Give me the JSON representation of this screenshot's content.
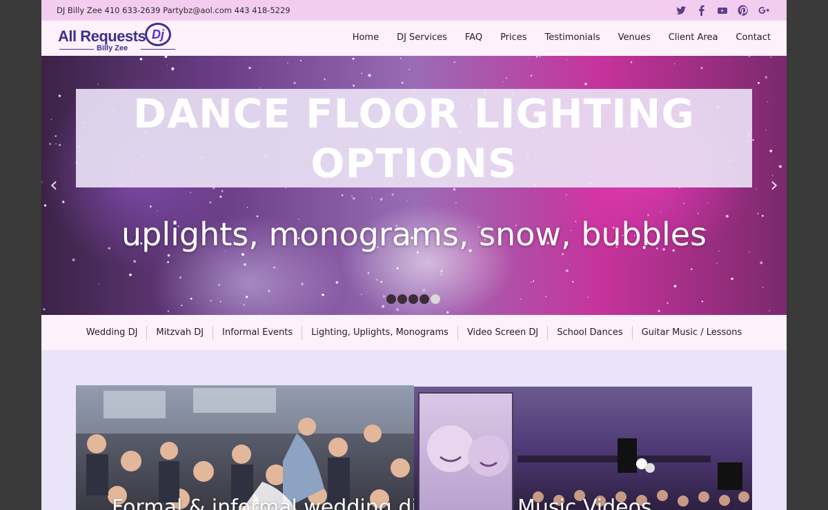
{
  "topbar": {
    "contact": "DJ Billy Zee 410 633-2639 Partybz@aol.com 443 418-5229",
    "social": [
      {
        "icon": "twitter-icon",
        "glyph": "t"
      },
      {
        "icon": "facebook-icon",
        "glyph": "f"
      },
      {
        "icon": "youtube-icon",
        "glyph": "You"
      },
      {
        "icon": "pinterest-icon",
        "glyph": "P"
      },
      {
        "icon": "google-plus-icon",
        "glyph": "g+"
      }
    ]
  },
  "logo": {
    "main": "All Requests",
    "badge": "Dj",
    "sub": "Billy Zee"
  },
  "nav": {
    "items": [
      "Home",
      "DJ Services",
      "FAQ",
      "Prices",
      "Testimonials",
      "Venues",
      "Client Area",
      "Contact"
    ]
  },
  "hero": {
    "title_line1": "DANCE FLOOR LIGHTING",
    "title_line2": "OPTIONS",
    "subtitle": "uplights, monograms, snow, bubbles",
    "prev": "‹",
    "next": "›",
    "slide_count": 5,
    "active_slide": 5
  },
  "services": {
    "items": [
      "Wedding DJ",
      "Mitzvah DJ",
      "Informal Events",
      "Lighting, Uplights, Monograms",
      "Video Screen DJ",
      "School Dances",
      "Guitar Music / Lessons"
    ]
  },
  "content": {
    "caption1": "Formal & informal wedding dj",
    "caption2": "Music Videos"
  },
  "colors": {
    "topbar": "#f3cdef",
    "header": "#fdf1fc",
    "page": "#e9e4f7",
    "brand": "#3d2f8f"
  }
}
